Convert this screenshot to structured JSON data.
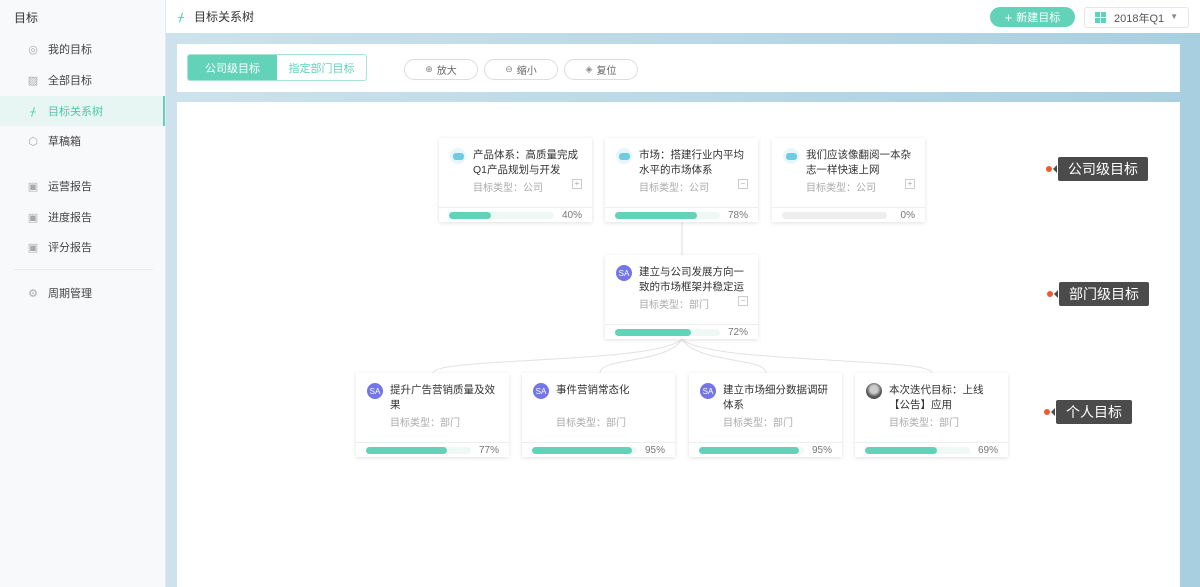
{
  "sidebar": {
    "title": "目标",
    "items": [
      {
        "label": "我的目标",
        "icon": "target-icon"
      },
      {
        "label": "全部目标",
        "icon": "chart-icon"
      },
      {
        "label": "目标关系树",
        "icon": "tree-icon",
        "active": true
      },
      {
        "label": "草稿箱",
        "icon": "box-icon"
      },
      {
        "label": "运营报告",
        "icon": "report-icon"
      },
      {
        "label": "进度报告",
        "icon": "progress-report-icon"
      },
      {
        "label": "评分报告",
        "icon": "score-report-icon"
      },
      {
        "label": "周期管理",
        "icon": "gear-icon"
      }
    ]
  },
  "header": {
    "title": "目标关系树",
    "new_button": "新建目标",
    "period": "2018年Q1"
  },
  "toolbar": {
    "tabs": [
      "公司级目标",
      "指定部门目标"
    ],
    "zoom_in": "放大",
    "zoom_out": "缩小",
    "reset": "复位"
  },
  "levels": [
    "公司级目标",
    "部门级目标",
    "个人目标"
  ],
  "company": [
    {
      "title": "产品体系：高质量完成Q1产品规划与开发",
      "type": "目标类型：公司",
      "progress": 40,
      "pct": "40%",
      "toggle": "+"
    },
    {
      "title": "市场：搭建行业内平均水平的市场体系",
      "type": "目标类型：公司",
      "progress": 78,
      "pct": "78%",
      "toggle": "−"
    },
    {
      "title": "我们应该像翻阅一本杂志一样快速上网",
      "type": "目标类型：公司",
      "progress": 0,
      "pct": "0%",
      "toggle": "+"
    }
  ],
  "department": [
    {
      "avatar": "SA",
      "title": "建立与公司发展方向一致的市场框架并稳定运",
      "type": "目标类型：部门",
      "progress": 72,
      "pct": "72%",
      "toggle": "−"
    }
  ],
  "personal": [
    {
      "avatar": "SA",
      "title": "提升广告营销质量及效果",
      "type": "目标类型：部门",
      "progress": 77,
      "pct": "77%"
    },
    {
      "avatar": "SA",
      "title": "事件营销常态化",
      "type": "目标类型：部门",
      "progress": 95,
      "pct": "95%"
    },
    {
      "avatar": "SA",
      "title": "建立市场细分数据调研体系",
      "type": "目标类型：部门",
      "progress": 95,
      "pct": "95%"
    },
    {
      "avatar": "",
      "title": "本次迭代目标：上线【公告】应用",
      "type": "目标类型：部门",
      "progress": 69,
      "pct": "69%"
    }
  ]
}
